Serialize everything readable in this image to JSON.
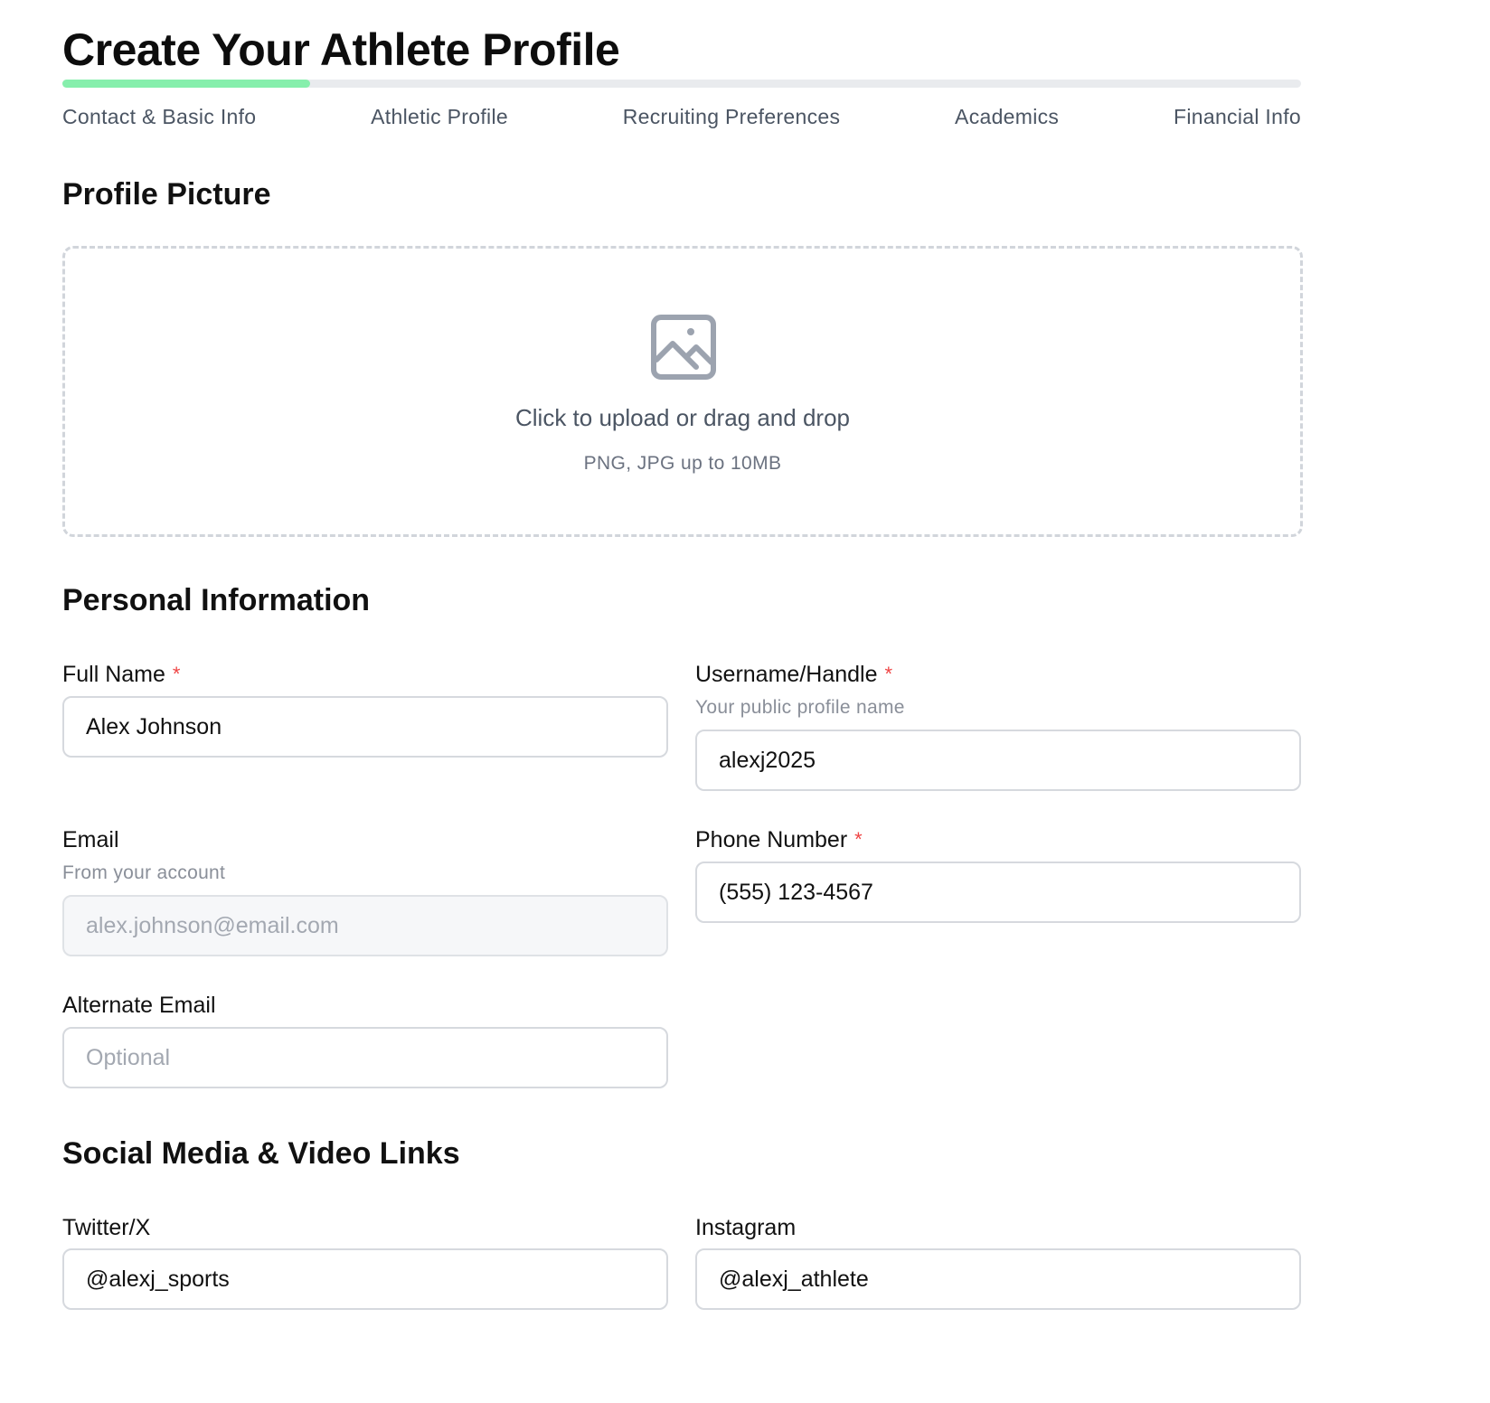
{
  "header": {
    "title": "Create Your Athlete Profile",
    "progress": 0.2
  },
  "steps": [
    {
      "label": "Contact & Basic Info"
    },
    {
      "label": "Athletic Profile"
    },
    {
      "label": "Recruiting Preferences"
    },
    {
      "label": "Academics"
    },
    {
      "label": "Financial Info"
    }
  ],
  "profile_picture": {
    "section_title": "Profile Picture",
    "icon": "image-icon",
    "upload_text": "Click to upload or drag and drop",
    "upload_hint": "PNG, JPG up to 10MB"
  },
  "personal": {
    "section_title": "Personal Information",
    "required_marker": "*",
    "full_name": {
      "label": "Full Name",
      "value": "Alex Johnson"
    },
    "username": {
      "label": "Username/Handle",
      "helper": "Your public profile name",
      "value": "alexj2025"
    },
    "email": {
      "label": "Email",
      "helper": "From your account",
      "value": "alex.johnson@email.com"
    },
    "phone": {
      "label": "Phone Number",
      "value": "(555) 123-4567"
    },
    "alternate_email": {
      "label": "Alternate Email",
      "placeholder": "Optional"
    }
  },
  "social": {
    "section_title": "Social Media & Video Links",
    "twitter": {
      "label": "Twitter/X",
      "value": "@alexj_sports"
    },
    "instagram": {
      "label": "Instagram",
      "value": "@alexj_athlete"
    }
  },
  "colors": {
    "progress_fill": "#86efac",
    "progress_track": "#e9ebee",
    "required": "#ef4444"
  }
}
